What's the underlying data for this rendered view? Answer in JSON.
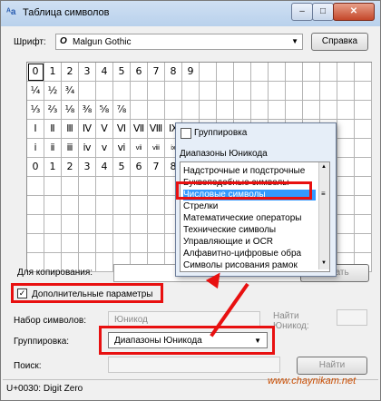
{
  "window": {
    "title": "Таблица символов",
    "app_icon": "charmap-icon",
    "controls": {
      "minimize": "–",
      "maximize": "□",
      "close": "✕"
    }
  },
  "font_row": {
    "label": "Шрифт:",
    "font_icon": "O",
    "value": "Malgun Gothic",
    "help_button": "Справка"
  },
  "grid": {
    "rows": [
      [
        "0",
        "1",
        "2",
        "3",
        "4",
        "5",
        "6",
        "7",
        "8",
        "9",
        "",
        "",
        "",
        "",
        "",
        "",
        "",
        "",
        "",
        ""
      ],
      [
        "¼",
        "½",
        "¾",
        "",
        "",
        "",
        "",
        "",
        "",
        "",
        "",
        "",
        "",
        "",
        "",
        "",
        "",
        "",
        "",
        ""
      ],
      [
        "⅓",
        "⅔",
        "⅛",
        "⅜",
        "⅝",
        "⅞",
        "",
        "",
        "",
        "",
        "",
        "",
        "",
        "",
        "",
        "",
        "",
        "",
        "",
        ""
      ],
      [
        "Ⅰ",
        "Ⅱ",
        "Ⅲ",
        "Ⅳ",
        "Ⅴ",
        "Ⅵ",
        "Ⅶ",
        "Ⅷ",
        "Ⅸ",
        "Ⅹ",
        "",
        "",
        "",
        "",
        "",
        "",
        "",
        "",
        "",
        ""
      ],
      [
        "ⅰ",
        "ⅱ",
        "ⅲ",
        "ⅳ",
        "ⅴ",
        "ⅵ",
        "ⅶ",
        "ⅷ",
        "ⅸ",
        "ⅹ",
        "",
        "",
        "",
        "",
        "",
        "",
        "",
        "",
        "",
        ""
      ],
      [
        "0",
        "1",
        "2",
        "3",
        "4",
        "5",
        "6",
        "7",
        "8",
        "9",
        "",
        "",
        "",
        "",
        "",
        "",
        "",
        "",
        "",
        ""
      ],
      [
        "",
        "",
        "",
        "",
        "",
        "",
        "",
        "",
        "",
        "",
        "",
        "",
        "",
        "",
        "",
        "",
        "",
        "",
        "",
        ""
      ],
      [
        "",
        "",
        "",
        "",
        "",
        "",
        "",
        "",
        "",
        "",
        "",
        "",
        "",
        "",
        "",
        "",
        "",
        "",
        "",
        ""
      ],
      [
        "",
        "",
        "",
        "",
        "",
        "",
        "",
        "",
        "",
        "",
        "",
        "",
        "",
        "",
        "",
        "",
        "",
        "",
        "",
        ""
      ],
      [
        "",
        "",
        "",
        "",
        "",
        "",
        "",
        "",
        "",
        "",
        "",
        "",
        "",
        "",
        "",
        "",
        "",
        "",
        "",
        ""
      ],
      [
        "",
        "",
        "",
        "",
        "",
        "",
        "",
        "",
        "",
        "",
        "",
        "",
        "",
        "",
        "",
        "",
        "",
        "",
        "",
        ""
      ]
    ],
    "selected_char": "0"
  },
  "copy": {
    "label": "Для копирования:",
    "value": "",
    "copy_button": "ровать"
  },
  "advanced": {
    "label": "Дополнительные параметры",
    "checked": true,
    "check_mark": "✓"
  },
  "charset": {
    "label": "Набор символов:",
    "value": "Юникод",
    "goto_label": "Найти",
    "goto_label2": "Юникод:"
  },
  "grouping": {
    "label": "Группировка:",
    "value": "Диапазоны Юникода",
    "arrow": "▼"
  },
  "search": {
    "label": "Поиск:",
    "value": "",
    "find_button": "Найти"
  },
  "status": {
    "text": "U+0030: Digit Zero"
  },
  "popup": {
    "title": "Группировка",
    "subtitle": "Диапазоны Юникода",
    "items": [
      "Надстрочные и подстрочные",
      "Буквоподобные символы",
      "Числовые символы",
      "Стрелки",
      "Математические операторы",
      "Технические символы",
      "Управляющие и OCR",
      "Алфавитно-цифровые обра",
      "Символы рисования рамок"
    ],
    "selected_index": 2,
    "scroll_up": "▲",
    "scroll_down": "▼",
    "scroll_grip": "≡"
  },
  "watermark": "www.chaynikam.net",
  "colors": {
    "highlight": "#e81010",
    "selection": "#3399ff",
    "titlebar": "#b9d1ec"
  }
}
